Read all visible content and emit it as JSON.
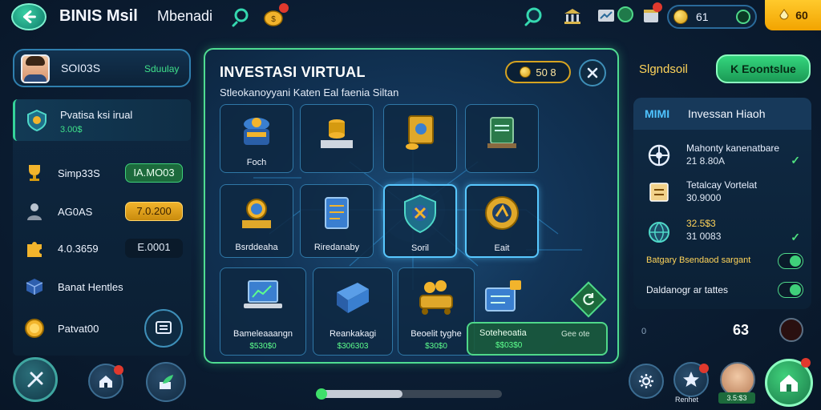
{
  "header": {
    "title": "BINIS Msil",
    "subtitle": "Mbenadi",
    "coins": "61",
    "gold": "60"
  },
  "profile": {
    "name": "SOI03S",
    "status": "Sduulay"
  },
  "sidebar": {
    "items": [
      {
        "label": "Pvatisa ksi irual",
        "sub": "3.00$",
        "icon": "investment-icon"
      },
      {
        "label": "Simp33S",
        "value": "IA.MO03",
        "icon": "trophy-icon"
      },
      {
        "label": "AG0AS",
        "value": "7.0.200",
        "icon": "advisor-icon"
      },
      {
        "label": "4.0.3659",
        "value": "E.0001",
        "icon": "puzzle-icon"
      },
      {
        "label": "Banat Hentles",
        "icon": "cube-icon"
      },
      {
        "label": "Patvat00",
        "icon": "gold-coin-icon"
      }
    ]
  },
  "modal": {
    "title": "INVESTASI VIRTUAL",
    "subtitle": "Stleokanoyyani Katen Eal faenia Siltan",
    "balance": "50 8",
    "cards_row1": [
      {
        "label": "Foch",
        "icon": "bank-icon"
      },
      {
        "label": "",
        "icon": "gold-bars-icon"
      },
      {
        "label": "",
        "icon": "gold-safe-icon"
      },
      {
        "label": "",
        "icon": "tablet-icon"
      }
    ],
    "cards_row2": [
      {
        "label": "Bsrddeaha",
        "icon": "coin-stack-icon"
      },
      {
        "label": "Riredanaby",
        "icon": "clipboard-icon"
      },
      {
        "label": "Soril",
        "icon": "shield-tools-icon"
      },
      {
        "label": "Eait",
        "icon": "target-icon"
      }
    ],
    "cards_row3": [
      {
        "label": "Bameleaaangn",
        "value": "$530$0",
        "icon": "laptop-chart-icon"
      },
      {
        "label": "Reankakagi",
        "value": "$306303",
        "icon": "book-icon"
      },
      {
        "label": "Beoelit tyghe",
        "value": "$30$0",
        "icon": "gold-cart-icon"
      },
      {
        "label": "Soteheoatia",
        "value": "$$03$0",
        "icon": "card-machine-icon"
      }
    ],
    "extra_label": "Gee ote"
  },
  "right": {
    "title": "Slgndsoil",
    "button": "K Eoontslue",
    "panel_tag": "MIMI",
    "panel_title": "Invessan Hiaoh",
    "items": [
      {
        "title": "Mahonty kanenatbare",
        "value": "21 8.80A",
        "icon": "wheel-icon",
        "checked": true
      },
      {
        "title": "Tetalcay Vortelat",
        "value": "30.9000",
        "icon": "box-icon",
        "checked": false
      },
      {
        "title": "32.5$3",
        "value": "31 0083",
        "icon": "globe-icon",
        "checked": true
      }
    ],
    "option1": "Batgary Bsendaod sargant",
    "option2": "Daldanogr ar tattes",
    "small_val": "0",
    "badge": "63"
  },
  "bottom": {
    "star_label": "Renhet",
    "avatar_label": "3.5:$3",
    "progress": 0.46
  }
}
